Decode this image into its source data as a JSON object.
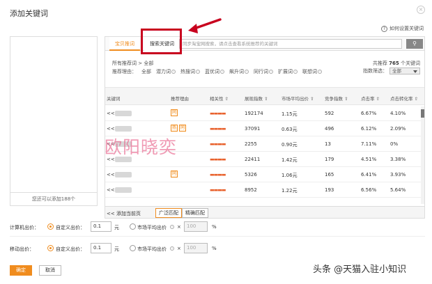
{
  "dialog": {
    "title": "添加关键词",
    "close": "×"
  },
  "help": {
    "label": "如何设置关键词"
  },
  "left_panel": {
    "hint": "您还可以添加188个"
  },
  "tabs": [
    {
      "label": "宝贝推词"
    },
    {
      "label": "搜索关键词"
    }
  ],
  "search": {
    "placeholder": "同步淘宝网搜索，请点击查看系统推荐的关键词",
    "button_icon": "search-icon"
  },
  "filters": {
    "all_recommended": "所有推荐词 >",
    "all_recommended_value": "全部",
    "reason_label": "推荐理由：",
    "reasons": [
      "全部",
      "潜力词",
      "热搜词",
      "蓝优词",
      "飙升词",
      "同行词",
      "扩展词",
      "联想词"
    ],
    "total_prefix": "共推荐",
    "total_count": "765",
    "total_suffix": "个关键词",
    "index_filter_label": "指数筛选：",
    "index_filter_value": "全部"
  },
  "table": {
    "headers": [
      "关键词",
      "推荐理由",
      "相关性 ⇧",
      "展现指数 ⇧",
      "市场平均出价 ⇧",
      "竞争指数 ⇧",
      "点击率 ⇧",
      "点击转化率 ⇧"
    ],
    "rows": [
      {
        "keyword": "<<",
        "tags": [
          "同"
        ],
        "impressions": "192174",
        "avg_bid": "1.15元",
        "competition": "592",
        "ctr": "6.67%",
        "cvr": "4.10%"
      },
      {
        "keyword": "<<",
        "tags": [
          "热",
          "同"
        ],
        "impressions": "37091",
        "avg_bid": "0.63元",
        "competition": "496",
        "ctr": "6.12%",
        "cvr": "2.09%"
      },
      {
        "keyword": "<<",
        "tags": [],
        "impressions": "2255",
        "avg_bid": "0.90元",
        "competition": "13",
        "ctr": "7.11%",
        "cvr": "0%"
      },
      {
        "keyword": "<<",
        "tags": [],
        "impressions": "22411",
        "avg_bid": "1.42元",
        "competition": "179",
        "ctr": "4.51%",
        "cvr": "3.38%"
      },
      {
        "keyword": "<<",
        "tags": [
          "同"
        ],
        "impressions": "5326",
        "avg_bid": "1.06元",
        "competition": "165",
        "ctr": "6.41%",
        "cvr": "3.93%"
      },
      {
        "keyword": "<<",
        "tags": [],
        "impressions": "8952",
        "avg_bid": "1.22元",
        "competition": "193",
        "ctr": "6.56%",
        "cvr": "5.64%"
      }
    ],
    "relevance_mark": "▬▬▬▬"
  },
  "bottom_bar": {
    "add_page": "<< 添加当前页",
    "broad_match": "广泛匹配",
    "exact_match": "精确匹配"
  },
  "bid_pc": {
    "label": "计算机出价：",
    "custom_label": "自定义出价：",
    "custom_value": "0.1",
    "unit": "元",
    "market_label": "市场平均出价",
    "times": "×",
    "percent_value": "100",
    "percent_sign": "%"
  },
  "bid_mobile": {
    "label": "移动出价：",
    "custom_label": "自定义出价：",
    "custom_value": "0.1",
    "unit": "元",
    "market_label": "市场平均出价",
    "times": "×",
    "percent_value": "100",
    "percent_sign": "%"
  },
  "buttons": {
    "ok": "确定",
    "cancel": "取消"
  },
  "overlay": {
    "watermark": "欧阳晓奕",
    "credit": "头条 @天猫入驻小知识"
  },
  "colors": {
    "accent": "#f08c1e",
    "highlight": "#c8001e"
  }
}
